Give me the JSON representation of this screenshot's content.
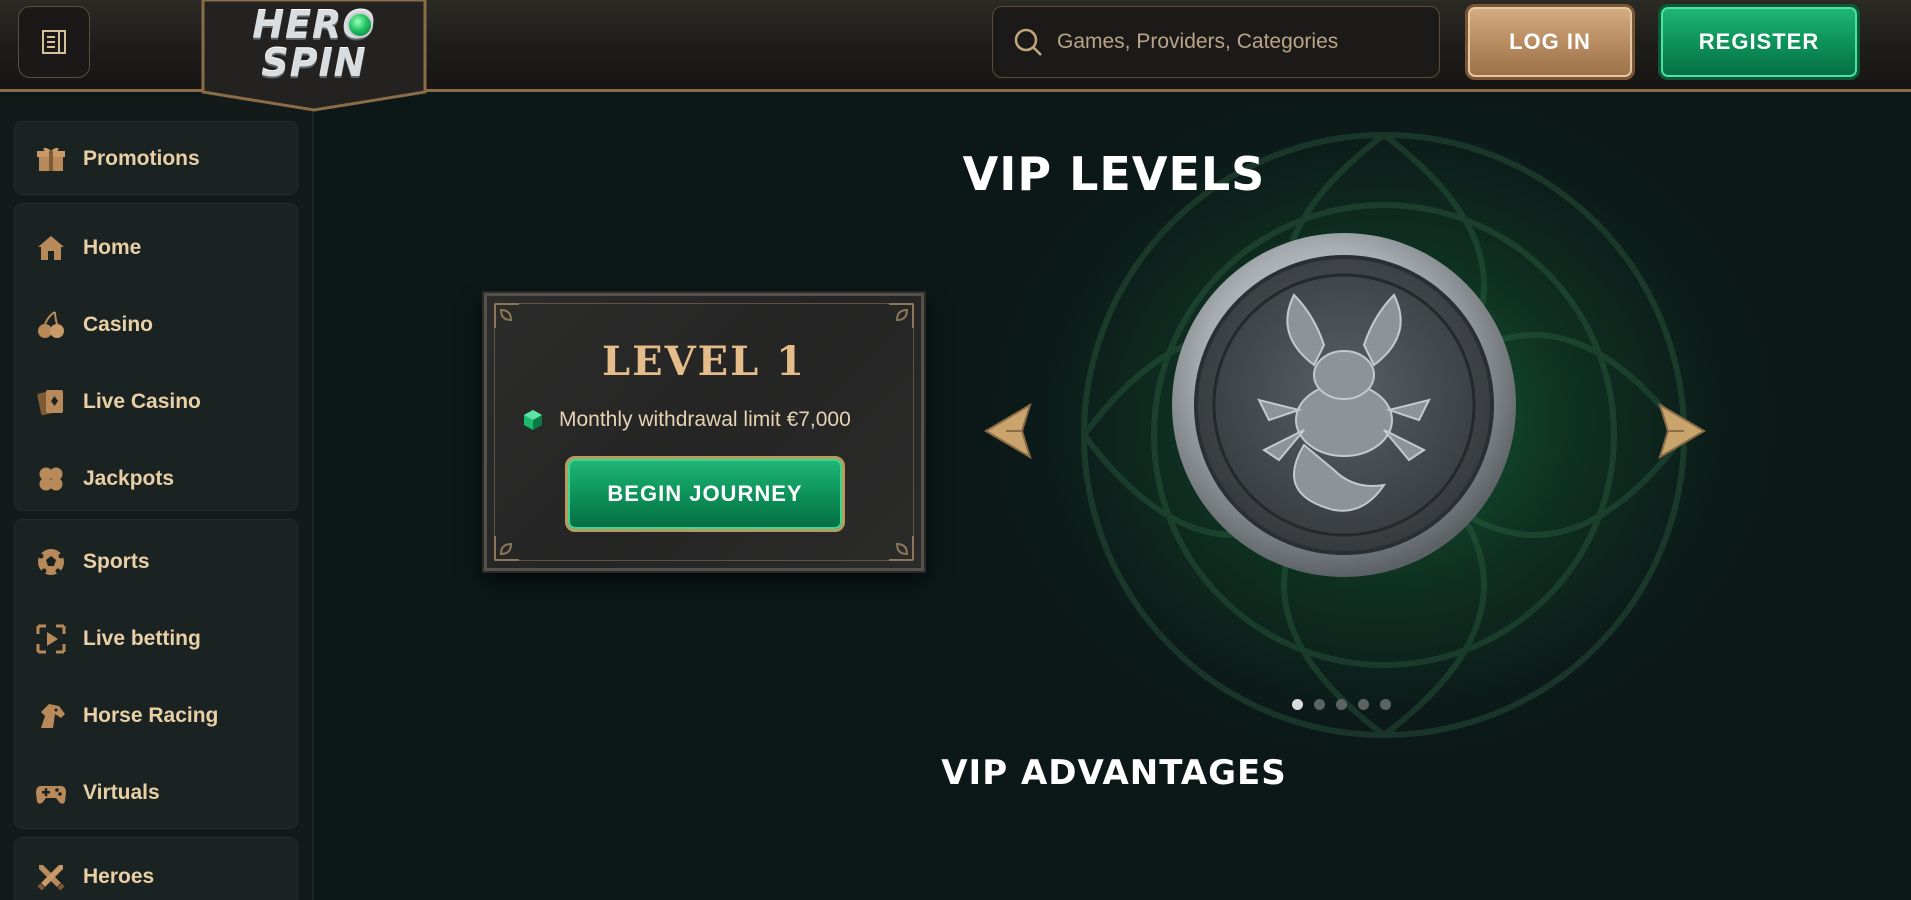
{
  "header": {
    "logo_text": "HERO SPIN",
    "search_placeholder": "Games, Providers, Categories",
    "login_label": "LOG IN",
    "register_label": "REGISTER"
  },
  "sidebar": {
    "items": [
      {
        "label": "Promotions",
        "icon": "gift-icon"
      },
      {
        "label": "Home",
        "icon": "home-icon"
      },
      {
        "label": "Casino",
        "icon": "cherries-icon"
      },
      {
        "label": "Live Casino",
        "icon": "playing-cards-icon"
      },
      {
        "label": "Jackpots",
        "icon": "clover-icon"
      },
      {
        "label": "Sports",
        "icon": "soccer-ball-icon"
      },
      {
        "label": "Live betting",
        "icon": "play-screen-icon"
      },
      {
        "label": "Horse Racing",
        "icon": "horse-head-icon"
      },
      {
        "label": "Virtuals",
        "icon": "gamepad-icon"
      },
      {
        "label": "Heroes",
        "icon": "crossed-swords-icon"
      }
    ]
  },
  "main": {
    "vip_title": "VIP LEVELS",
    "level_card": {
      "title": "LEVEL 1",
      "benefit": "Monthly withdrawal limit €7,000",
      "button_label": "BEGIN JOURNEY"
    },
    "carousel": {
      "total_slides": 5,
      "active_slide": 1,
      "medal": "scorpion-medal"
    },
    "advantages_title": "VIP ADVANTAGES"
  },
  "colors": {
    "background": "#0c1718",
    "accent_gold": "#e4bd8a",
    "accent_green": "#0c8f58",
    "sidebar_text": "#e8cfa5"
  }
}
